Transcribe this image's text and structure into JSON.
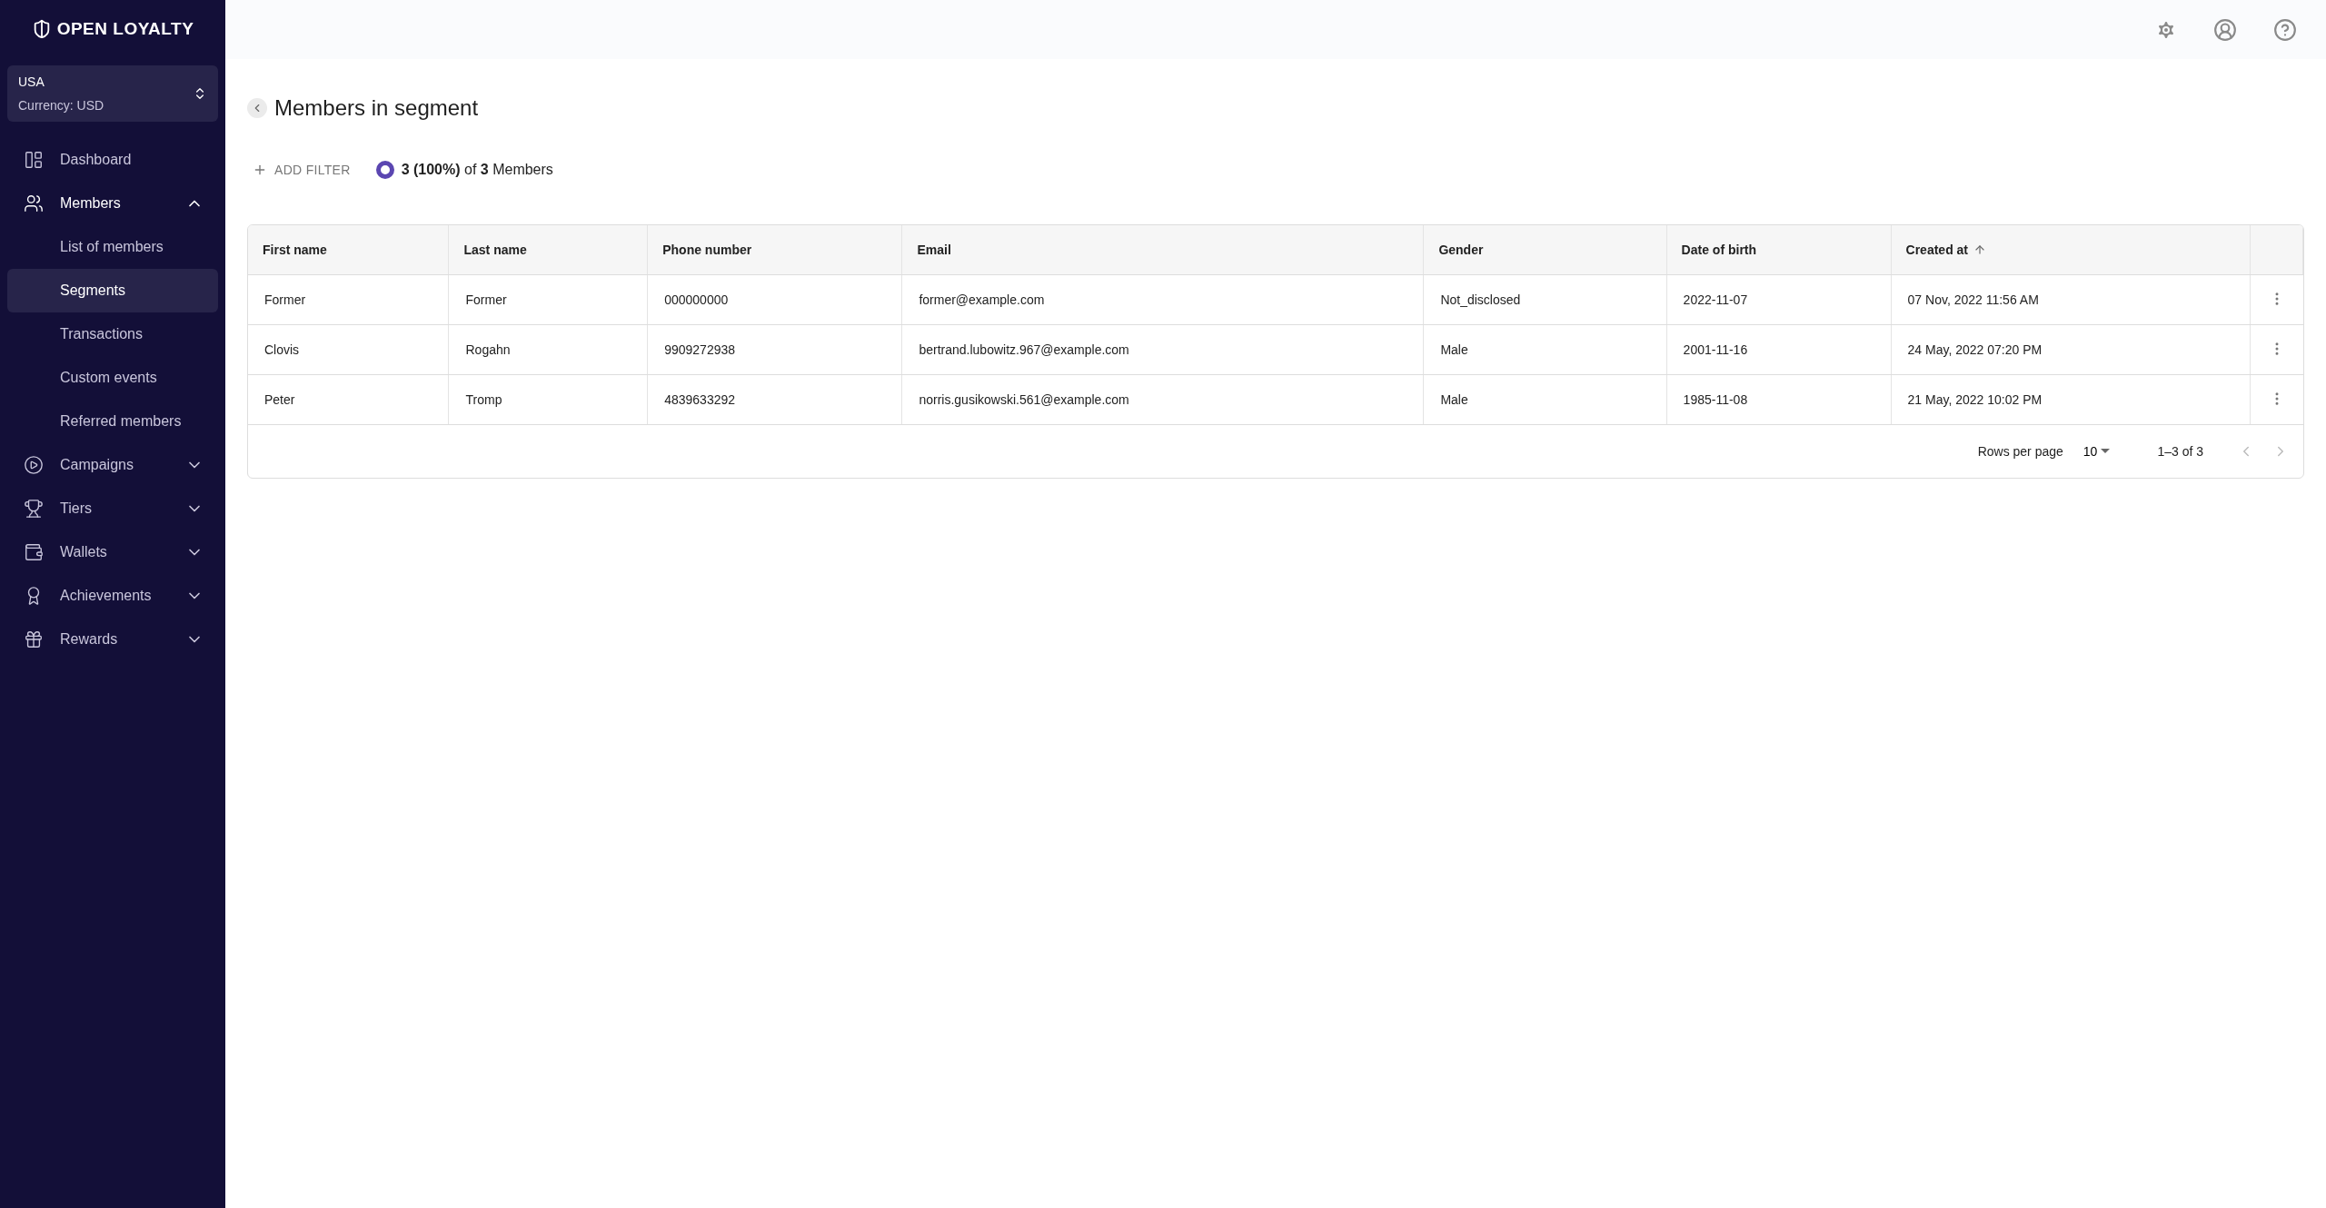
{
  "brand": {
    "name": "OPEN LOYALTY"
  },
  "store_selector": {
    "name": "USA",
    "currency": "Currency: USD"
  },
  "sidebar": {
    "items": [
      {
        "label": "Dashboard",
        "kind": "link",
        "selected": false
      },
      {
        "label": "Members",
        "kind": "group",
        "expanded": true,
        "selected": false,
        "children": [
          {
            "label": "List of members",
            "selected": false
          },
          {
            "label": "Segments",
            "selected": true
          },
          {
            "label": "Transactions",
            "selected": false
          },
          {
            "label": "Custom events",
            "selected": false
          },
          {
            "label": "Referred members",
            "selected": false
          }
        ]
      },
      {
        "label": "Campaigns",
        "kind": "group",
        "expanded": false,
        "selected": false
      },
      {
        "label": "Tiers",
        "kind": "group",
        "expanded": false,
        "selected": false
      },
      {
        "label": "Wallets",
        "kind": "group",
        "expanded": false,
        "selected": false
      },
      {
        "label": "Achievements",
        "kind": "group",
        "expanded": false,
        "selected": false
      },
      {
        "label": "Rewards",
        "kind": "group",
        "expanded": false,
        "selected": false
      }
    ]
  },
  "page": {
    "title": "Members in segment"
  },
  "filter_bar": {
    "add_filter": "ADD FILTER",
    "count": "**3 (100%)** of **3** Members"
  },
  "table": {
    "columns": [
      {
        "label": "First name",
        "sorted": false
      },
      {
        "label": "Last name",
        "sorted": false
      },
      {
        "label": "Phone number",
        "sorted": false
      },
      {
        "label": "Email",
        "sorted": false
      },
      {
        "label": "Gender",
        "sorted": false
      },
      {
        "label": "Date of birth",
        "sorted": false
      },
      {
        "label": "Created at",
        "sorted": true
      }
    ],
    "rows": [
      [
        "Former",
        "Former",
        "000000000",
        "former@example.com",
        "Not_disclosed",
        "2022-11-07",
        "07 Nov, 2022 11:56 AM"
      ],
      [
        "Clovis",
        "Rogahn",
        "9909272938",
        "bertrand.lubowitz.967@example.com",
        "Male",
        "2001-11-16",
        "24 May, 2022 07:20 PM"
      ],
      [
        "Peter",
        "Tromp",
        "4839633292",
        "norris.gusikowski.561@example.com",
        "Male",
        "1985-11-08",
        "21 May, 2022 10:02 PM"
      ]
    ],
    "pagination": {
      "rows_per_page_label": "Rows per page",
      "rows_per_page": "10",
      "range": "1–3 of 3",
      "prev_disabled": true,
      "next_disabled": true
    }
  }
}
